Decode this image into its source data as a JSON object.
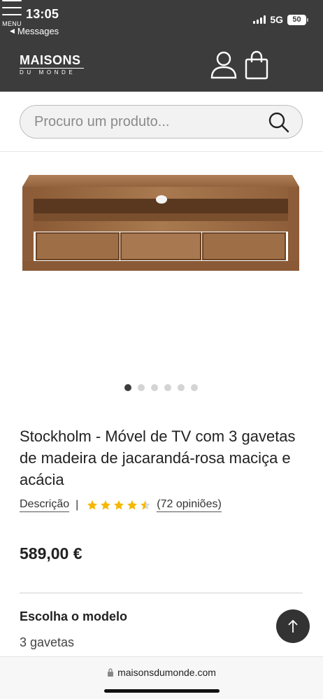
{
  "status_bar": {
    "time": "13:05",
    "back_label": "Messages",
    "network": "5G",
    "battery": "50"
  },
  "header": {
    "logo_main": "MAISONS",
    "logo_sub": "DU MONDE",
    "menu_label": "MENU",
    "icons": [
      "user-icon",
      "shopping-bag-icon",
      "hamburger-menu-icon"
    ]
  },
  "search": {
    "placeholder": "Procuro um produto..."
  },
  "carousel": {
    "count": 6,
    "active_index": 0
  },
  "product": {
    "title": "Stockholm - Móvel de TV com 3 gavetas de madeira de jacarandá-rosa maciça e acácia",
    "description_link": "Descrição",
    "separator": "|",
    "rating": 4.5,
    "rating_max": 5,
    "reviews": "(72 opiniões)",
    "price": "589,00 €",
    "choose_model_label": "Escolha o modelo",
    "selected_model": "3 gavetas"
  },
  "browser": {
    "url": "maisonsdumonde.com"
  },
  "colors": {
    "header_bg": "#3c3c3c",
    "star": "#f5b700",
    "wood": "#9a6b43"
  }
}
